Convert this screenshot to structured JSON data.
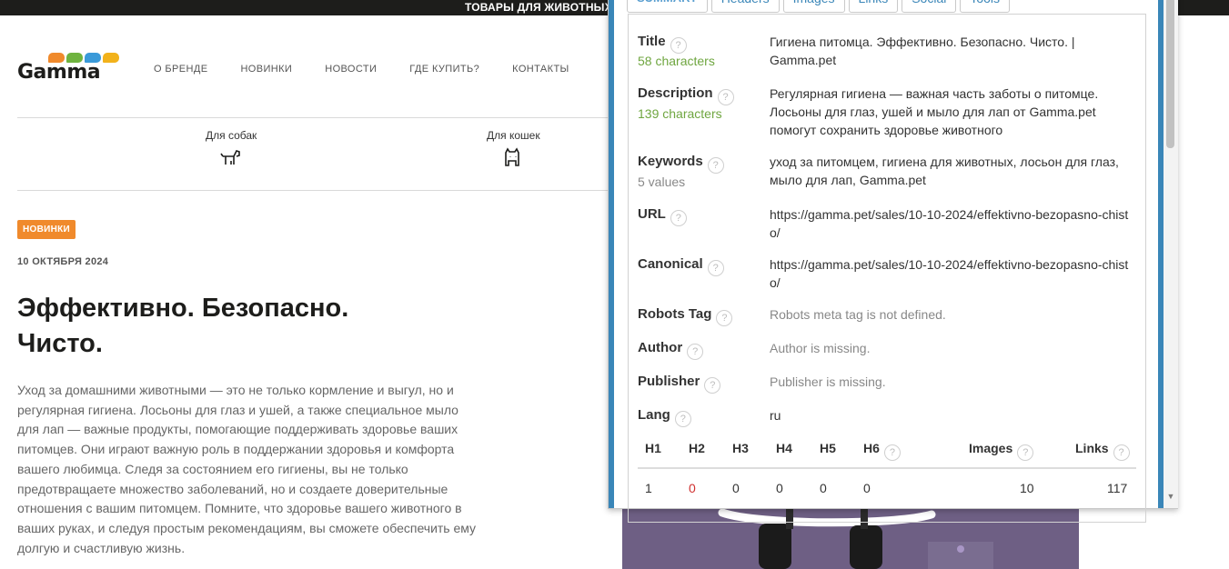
{
  "site": {
    "topbar": "ТОВАРЫ ДЛЯ ЖИВОТНЫХ",
    "logo": "Gamma",
    "logo_colors": [
      "#f08a2c",
      "#6fb33f",
      "#3a9ad9",
      "#f2b21b"
    ],
    "nav": [
      "О БРЕНДЕ",
      "НОВИНКИ",
      "НОВОСТИ",
      "ГДЕ КУПИТЬ?",
      "КОНТАКТЫ"
    ],
    "categories": [
      "Для собак",
      "Для кошек"
    ],
    "badge": "НОВИНКИ",
    "date": "10 ОКТЯБРЯ 2024",
    "headline": "Эффективно. Безопасно. Чисто.",
    "body": "Уход за домашними животными — это не только кормление и выгул, но и регулярная гигиена. Лосьоны для глаз и ушей, а также специальное мыло для лап — важные продукты, помогающие поддерживать здоровье ваших питомцев. Они играют важную роль в поддержании здоровья и комфорта вашего любимца. Следя за состоянием его гигиены, вы не только предотвращаете множество заболеваний, но и создаете доверительные отношения с вашим питомцем. Помните, что здоровье вашего животного в ваших руках, и следуя простым рекомендациям, вы сможете обеспечить ему долгую и счастливую жизнь.",
    "accent": "#f08a2c"
  },
  "seo": {
    "tabs": [
      "Summary",
      "Headers",
      "Images",
      "Links",
      "Social",
      "Tools"
    ],
    "help": "?",
    "rows": {
      "title": {
        "label": "Title",
        "sub": "58 characters",
        "value": "Гигиена питомца. Эффективно. Безопасно. Чисто. | Gamma.pet"
      },
      "description": {
        "label": "Description",
        "sub": "139 characters",
        "value": "Регулярная гигиена — важная часть заботы о питомце. Лосьоны для глаз, ушей и мыло для лап от Gamma.pet помогут сохранить здоровье животного"
      },
      "keywords": {
        "label": "Keywords",
        "sub": "5 values",
        "value": "уход за питомцем, гигиена для животных, лосьон для глаз, мыло для лап, Gamma.pet"
      },
      "url": {
        "label": "URL",
        "value": "https://gamma.pet/sales/10-10-2024/effektivno-bezopasno-chisto/"
      },
      "canonical": {
        "label": "Canonical",
        "value": "https://gamma.pet/sales/10-10-2024/effektivno-bezopasno-chisto/"
      },
      "robots": {
        "label": "Robots Tag",
        "value": "Robots meta tag is not defined."
      },
      "author": {
        "label": "Author",
        "value": "Author is missing."
      },
      "publisher": {
        "label": "Publisher",
        "value": "Publisher is missing."
      },
      "lang": {
        "label": "Lang",
        "value": "ru"
      }
    },
    "headers_table": {
      "columns": [
        "H1",
        "H2",
        "H3",
        "H4",
        "H5",
        "H6",
        "Images",
        "Links"
      ],
      "values": [
        "1",
        "0",
        "0",
        "0",
        "0",
        "0",
        "10",
        "117"
      ]
    },
    "accent": "#3a86b8",
    "ok_color": "#6fa640",
    "error_color": "#d0302f"
  }
}
